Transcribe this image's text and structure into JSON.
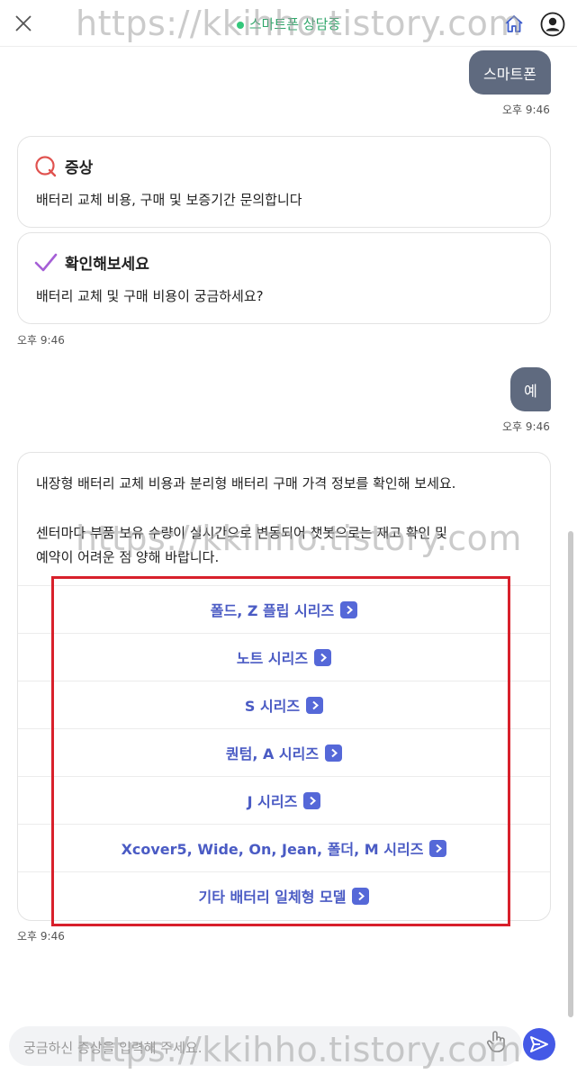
{
  "header": {
    "title": "스마트폰 상담중",
    "colors": {
      "status": "#34c77b"
    }
  },
  "watermark": {
    "text": "https://kkihho.tistory.com"
  },
  "messages": {
    "user1": {
      "text": "스마트폰",
      "time": "오후 9:46"
    },
    "symptom": {
      "title": "증상",
      "text": "배터리 교체 비용, 구매 및 보증기간 문의합니다",
      "icon": "search-q-icon"
    },
    "check": {
      "title": "확인해보세요",
      "text": "배터리 교체 및 구매 비용이 궁금하세요?",
      "icon": "check-icon"
    },
    "bot1_time": "오후 9:46",
    "user2": {
      "text": "예",
      "time": "오후 9:46"
    },
    "info": {
      "line1": "내장형 배터리 교체 비용과 분리형 배터리 구매 가격 정보를 확인해 보세요.",
      "line2": "센터마다 부품 보유 수량이 실시간으로 변동되어 챗봇으로는 재고 확인 및",
      "line3": "예약이 어려운 점 양해 바랍니다.",
      "options": [
        "폴드, Z 플립 시리즈",
        "노트 시리즈",
        "S 시리즈",
        "퀀텀, A 시리즈",
        "J 시리즈",
        "Xcover5, Wide, On, Jean, 폴더, M 시리즈",
        "기타 배터리 일체형 모델"
      ],
      "time": "오후 9:46"
    }
  },
  "input": {
    "placeholder": "궁금하신 증상을 입력해 주세요."
  },
  "colors": {
    "accent": "#4459e6",
    "link": "#4a5bc4",
    "user_bubble": "#5f6a7f",
    "highlight": "#d8202b"
  }
}
